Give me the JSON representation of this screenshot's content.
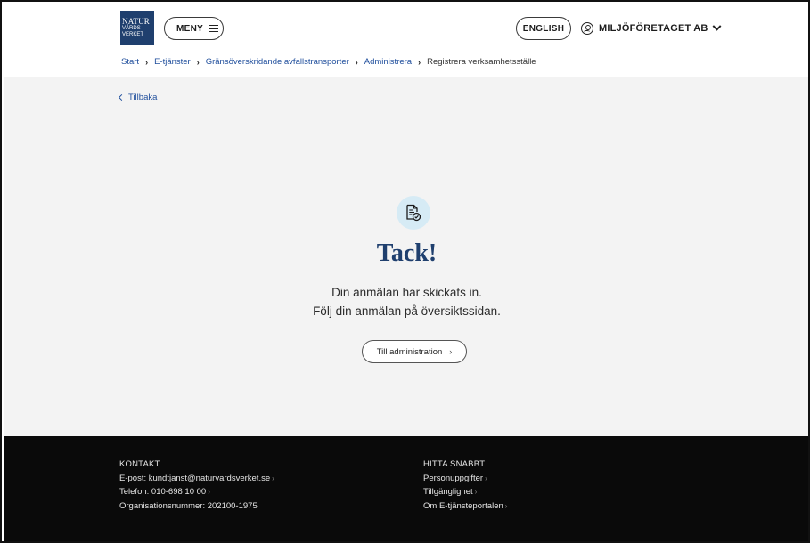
{
  "header": {
    "logo": {
      "line1": "NATUR",
      "line2": "VÅRDS",
      "line3": "VERKET"
    },
    "menu_label": "MENY",
    "language_label": "ENGLISH",
    "account_label": "MILJÖFÖRETAGET AB"
  },
  "breadcrumb": {
    "items": [
      "Start",
      "E-tjänster",
      "Gränsöverskridande avfallstransporter",
      "Administrera"
    ],
    "current": "Registrera verksamhetsställe"
  },
  "main": {
    "back_label": "Tillbaka",
    "title": "Tack!",
    "message_line1": "Din anmälan har skickats in.",
    "message_line2": "Följ din anmälan på översiktssidan.",
    "button_label": "Till administration"
  },
  "footer": {
    "contact": {
      "heading": "KONTAKT",
      "email": "E-post: kundtjanst@naturvardsverket.se",
      "phone": "Telefon: 010-698 10 00",
      "org": "Organisationsnummer: 202100-1975"
    },
    "quick": {
      "heading": "HITTA SNABBT",
      "links": [
        "Personuppgifter",
        "Tillgänglighet",
        "Om E-tjänsteportalen"
      ]
    }
  },
  "colors": {
    "brand": "#1f3f6e",
    "link": "#1f4e9c",
    "footer_bg": "#0a0a0a",
    "main_bg": "#f3f3f3",
    "icon_bg": "#d6ebf5"
  },
  "icons": {
    "menu": "hamburger-icon",
    "account": "user-circle-icon",
    "dropdown": "chevron-down-icon",
    "confirmation": "document-check-icon"
  }
}
